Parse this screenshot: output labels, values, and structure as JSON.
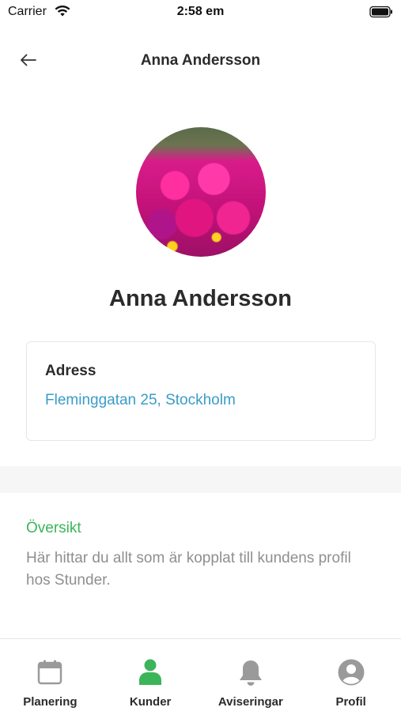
{
  "status_bar": {
    "carrier": "Carrier",
    "time": "2:58 em"
  },
  "header": {
    "title": "Anna Andersson",
    "back_icon": "arrow-left-icon"
  },
  "profile": {
    "name": "Anna Andersson"
  },
  "address_card": {
    "label": "Adress",
    "value": "Fleminggatan 25, Stockholm"
  },
  "overview": {
    "title": "Översikt",
    "description": "Här hittar du allt som är kopplat till kundens profil hos Stunder."
  },
  "tab_bar": {
    "tabs": [
      {
        "label": "Planering",
        "icon": "calendar-icon",
        "active": false
      },
      {
        "label": "Kunder",
        "icon": "person-icon",
        "active": true
      },
      {
        "label": "Aviseringar",
        "icon": "bell-icon",
        "active": false
      },
      {
        "label": "Profil",
        "icon": "user-circle-icon",
        "active": false
      }
    ]
  },
  "colors": {
    "accent_green": "#3cb55a",
    "link_blue": "#3a9cc8",
    "icon_gray": "#9a9a9a",
    "text_dark": "#2b2b2b",
    "text_muted": "#8f8f8f"
  }
}
